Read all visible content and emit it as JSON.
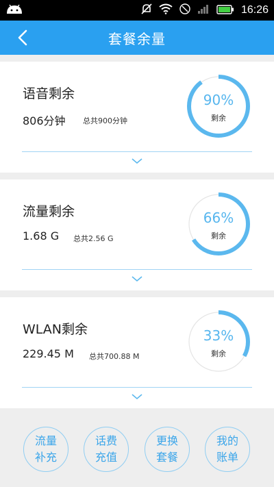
{
  "status_bar": {
    "time": "16:26"
  },
  "header": {
    "title": "套餐余量"
  },
  "cards": [
    {
      "name": "语音剩余",
      "remaining": "806分钟",
      "total": "总共900分钟",
      "percent": 90,
      "percent_label": "90%",
      "ring_label": "剩余"
    },
    {
      "name": "流量剩余",
      "remaining": "1.68 G",
      "total": "总共2.56 G",
      "percent": 66,
      "percent_label": "66%",
      "ring_label": "剩余"
    },
    {
      "name": "WLAN剩余",
      "remaining": "229.45 M",
      "total": "总共700.88 M",
      "percent": 33,
      "percent_label": "33%",
      "ring_label": "剩余"
    }
  ],
  "actions": [
    {
      "line1": "流量",
      "line2": "补充"
    },
    {
      "line1": "话费",
      "line2": "充值"
    },
    {
      "line1": "更换",
      "line2": "套餐"
    },
    {
      "line1": "我的",
      "line2": "账单"
    }
  ],
  "colors": {
    "accent": "#2aa0f0",
    "ring": "#5bb8ee",
    "ring_track": "#e4e4e4"
  }
}
